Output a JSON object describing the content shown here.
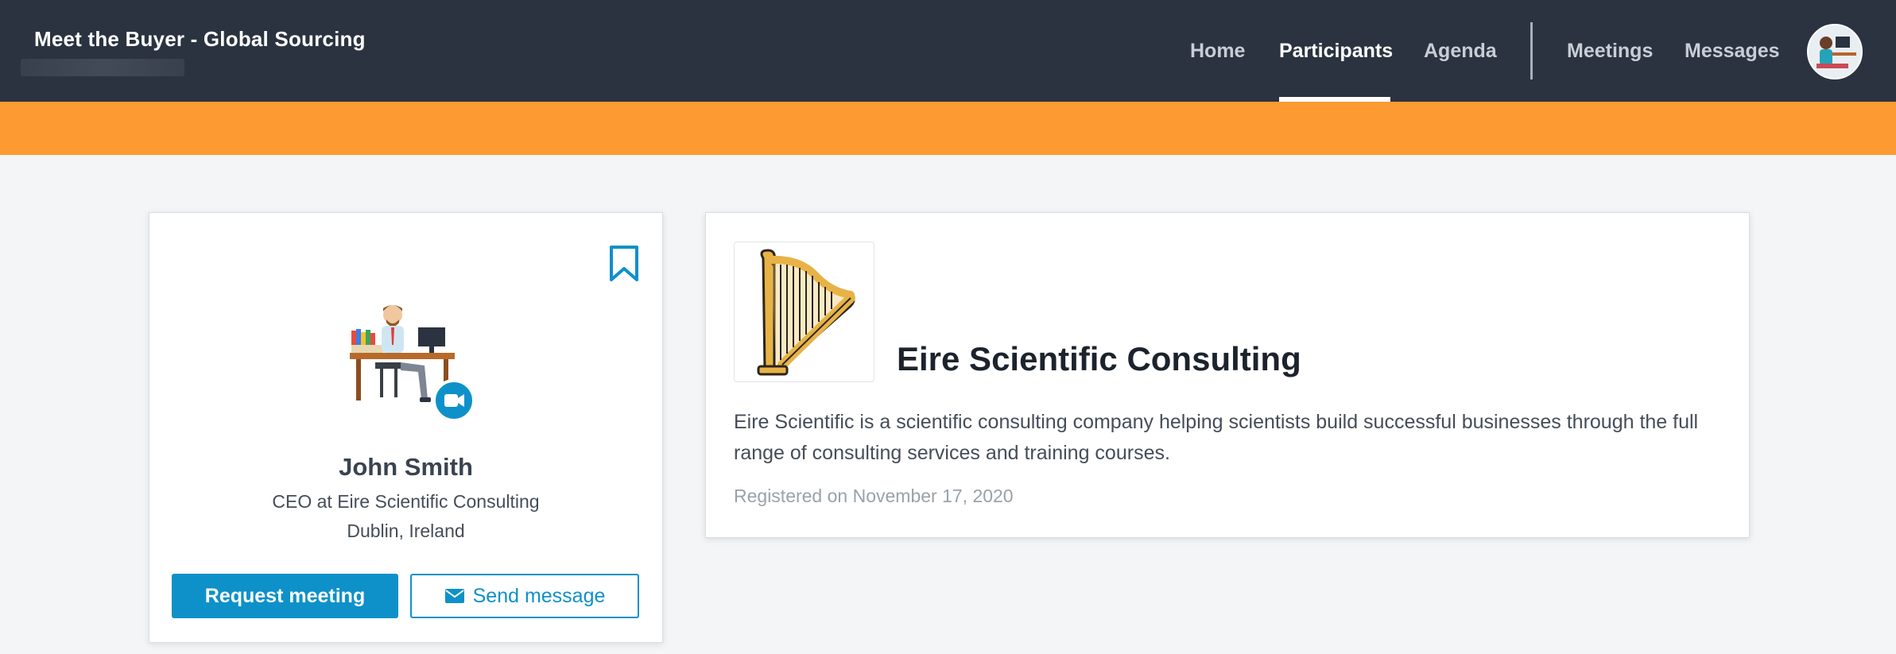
{
  "header": {
    "event_title": "Meet the Buyer - Global Sourcing",
    "nav": [
      {
        "label": "Home"
      },
      {
        "label": "Participants",
        "active": true
      },
      {
        "label": "Agenda"
      },
      {
        "label": "Meetings"
      },
      {
        "label": "Messages"
      }
    ]
  },
  "profile": {
    "name": "John Smith",
    "role": "CEO at Eire Scientific Consulting",
    "location": "Dublin, Ireland",
    "request_meeting_label": "Request meeting",
    "send_message_label": "Send message",
    "icons": [
      "bookmark-icon",
      "video-camera-icon",
      "envelope-icon"
    ]
  },
  "company": {
    "name": "Eire Scientific Consulting",
    "description": "Eire Scientific is a scientific consulting company helping scientists build successful businesses through the full range of consulting services and training courses.",
    "registered": "Registered on November 17, 2020",
    "logo_icon": "harp-icon"
  },
  "colors": {
    "header_bg": "#2b3340",
    "accent_orange": "#fd9a32",
    "primary_blue": "#0e91c9"
  }
}
